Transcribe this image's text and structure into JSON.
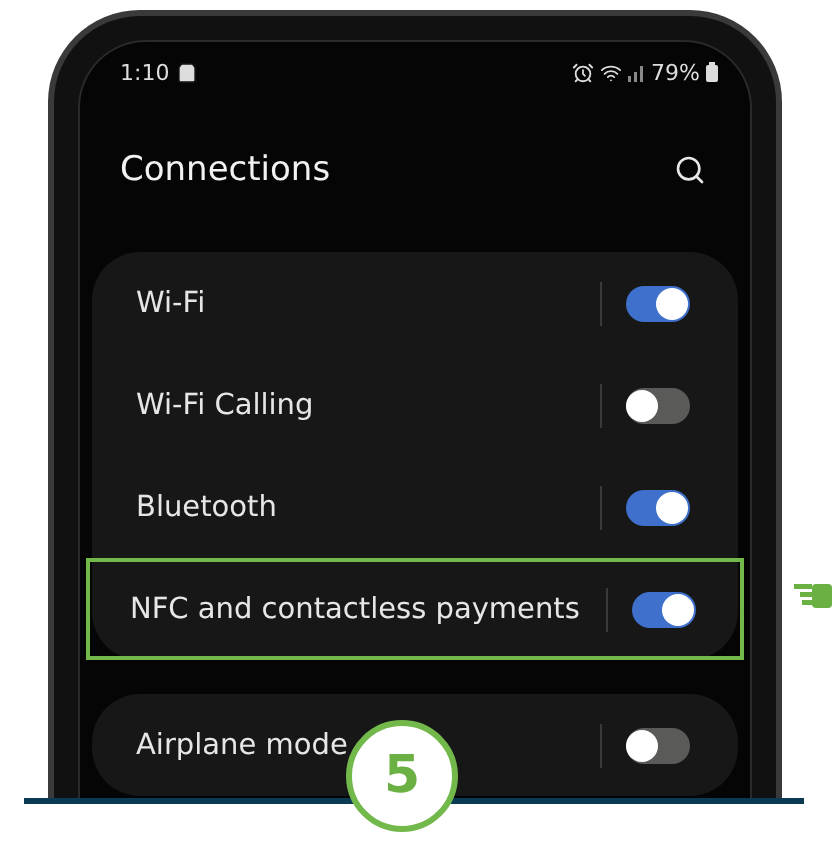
{
  "status_bar": {
    "time": "1:10",
    "battery": "79%"
  },
  "header": {
    "title": "Connections"
  },
  "cards": [
    {
      "rows": [
        {
          "label": "Wi-Fi",
          "on": true,
          "highlighted": false
        },
        {
          "label": "Wi-Fi Calling",
          "on": false,
          "highlighted": false
        },
        {
          "label": "Bluetooth",
          "on": true,
          "highlighted": false
        },
        {
          "label": "NFC and contactless payments",
          "on": true,
          "highlighted": true
        }
      ]
    },
    {
      "rows": [
        {
          "label": "Airplane mode",
          "on": false,
          "highlighted": false
        }
      ]
    }
  ],
  "step": {
    "number": "5"
  }
}
